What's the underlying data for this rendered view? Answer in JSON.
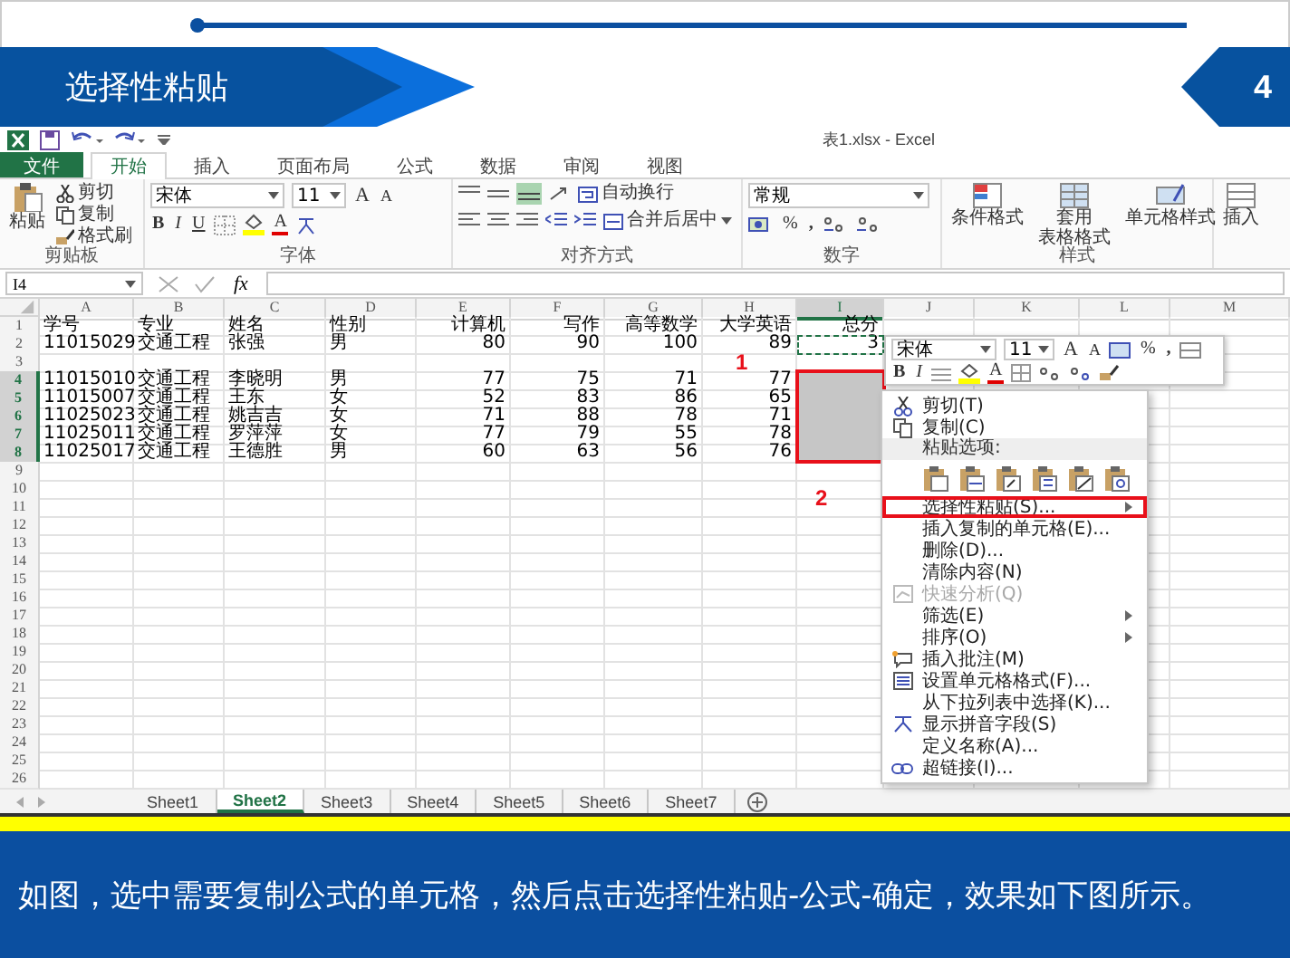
{
  "slide": {
    "title": "选择性粘贴",
    "page_number": "4",
    "caption": "如图，选中需要复制公式的单元格，然后点击选择性粘贴-公式-确定，效果如下图所示。"
  },
  "excel": {
    "window_title": "表1.xlsx - Excel",
    "tabs": [
      {
        "label": "文件",
        "kind": "file",
        "selected": false
      },
      {
        "label": "开始",
        "kind": "tab",
        "selected": true
      },
      {
        "label": "插入",
        "kind": "tab",
        "selected": false
      },
      {
        "label": "页面布局",
        "kind": "tab",
        "selected": false
      },
      {
        "label": "公式",
        "kind": "tab",
        "selected": false
      },
      {
        "label": "数据",
        "kind": "tab",
        "selected": false
      },
      {
        "label": "审阅",
        "kind": "tab",
        "selected": false
      },
      {
        "label": "视图",
        "kind": "tab",
        "selected": false
      }
    ],
    "ribbon": {
      "clipboard": {
        "label": "剪贴板",
        "paste": "粘贴",
        "cut": "剪切",
        "copy": "复制",
        "format_painter": "格式刷"
      },
      "font": {
        "label": "字体",
        "font_name": "宋体",
        "font_size": "11",
        "grow": "A",
        "shrink": "A",
        "bold": "B",
        "italic": "I",
        "underline": "U",
        "font_color": "A"
      },
      "alignment": {
        "label": "对齐方式",
        "wrap_text": "自动换行",
        "merge_center": "合并后居中"
      },
      "number": {
        "label": "数字",
        "format": "常规",
        "percent": "%",
        "comma": ","
      },
      "styles": {
        "label": "样式",
        "conditional": [
          "条件格式"
        ],
        "table": [
          "套用",
          "表格格式"
        ],
        "cell_styles": [
          "单元格样式"
        ]
      },
      "cells": {
        "insert": "插入"
      }
    },
    "name_box": "I4",
    "function_label": "fx",
    "columns": [
      {
        "label": "A",
        "kind": "text",
        "selected": false
      },
      {
        "label": "B",
        "kind": "text",
        "selected": false
      },
      {
        "label": "C",
        "kind": "text",
        "selected": false
      },
      {
        "label": "D",
        "kind": "text",
        "selected": false
      },
      {
        "label": "E",
        "kind": "number",
        "selected": false
      },
      {
        "label": "F",
        "kind": "number",
        "selected": false
      },
      {
        "label": "G",
        "kind": "number",
        "selected": false
      },
      {
        "label": "H",
        "kind": "number",
        "selected": false
      },
      {
        "label": "I",
        "kind": "number",
        "selected": true
      },
      {
        "label": "J",
        "selected": false
      },
      {
        "label": "K",
        "selected": false
      },
      {
        "label": "L",
        "selected": false
      },
      {
        "label": "M",
        "selected": false
      }
    ],
    "rows": [
      {
        "number": "1",
        "selected": false,
        "copied": false,
        "cells": [
          "学号",
          "专业",
          "姓名",
          "性别",
          "计算机",
          "写作",
          "高等数学",
          "大学英语",
          "总分"
        ]
      },
      {
        "number": "2",
        "selected": false,
        "copied": true,
        "cells": [
          "11015029",
          "交通工程",
          "张强",
          "男",
          "80",
          "90",
          "100",
          "89",
          "3"
        ]
      },
      {
        "number": "3",
        "selected": false,
        "copied": false,
        "cells": []
      },
      {
        "number": "4",
        "selected": true,
        "copied": false,
        "cells": [
          "11015010",
          "交通工程",
          "李晓明",
          "男",
          "77",
          "75",
          "71",
          "77"
        ]
      },
      {
        "number": "5",
        "selected": true,
        "copied": false,
        "cells": [
          "11015007",
          "交通工程",
          "王东",
          "女",
          "52",
          "83",
          "86",
          "65"
        ]
      },
      {
        "number": "6",
        "selected": true,
        "copied": false,
        "cells": [
          "11025023",
          "交通工程",
          "姚吉吉",
          "女",
          "71",
          "88",
          "78",
          "71"
        ]
      },
      {
        "number": "7",
        "selected": true,
        "copied": false,
        "cells": [
          "11025011",
          "交通工程",
          "罗萍萍",
          "女",
          "77",
          "79",
          "55",
          "78"
        ]
      },
      {
        "number": "8",
        "selected": true,
        "copied": false,
        "cells": [
          "11025017",
          "交通工程",
          "王德胜",
          "男",
          "60",
          "63",
          "56",
          "76"
        ]
      },
      {
        "number": "9",
        "selected": false,
        "copied": false,
        "cells": []
      },
      {
        "number": "10",
        "selected": false,
        "copied": false,
        "cells": []
      },
      {
        "number": "11",
        "selected": false,
        "copied": false,
        "cells": []
      },
      {
        "number": "12",
        "selected": false,
        "copied": false,
        "cells": []
      },
      {
        "number": "13",
        "selected": false,
        "copied": false,
        "cells": []
      },
      {
        "number": "14",
        "selected": false,
        "copied": false,
        "cells": []
      },
      {
        "number": "15",
        "selected": false,
        "copied": false,
        "cells": []
      },
      {
        "number": "16",
        "selected": false,
        "copied": false,
        "cells": []
      },
      {
        "number": "17",
        "selected": false,
        "copied": false,
        "cells": []
      },
      {
        "number": "18",
        "selected": false,
        "copied": false,
        "cells": []
      },
      {
        "number": "19",
        "selected": false,
        "copied": false,
        "cells": []
      },
      {
        "number": "20",
        "selected": false,
        "copied": false,
        "cells": []
      },
      {
        "number": "21",
        "selected": false,
        "copied": false,
        "cells": []
      },
      {
        "number": "22",
        "selected": false,
        "copied": false,
        "cells": []
      },
      {
        "number": "23",
        "selected": false,
        "copied": false,
        "cells": []
      },
      {
        "number": "24",
        "selected": false,
        "copied": false,
        "cells": []
      },
      {
        "number": "25",
        "selected": false,
        "copied": false,
        "cells": []
      },
      {
        "number": "26",
        "selected": false,
        "copied": false,
        "cells": []
      }
    ],
    "selection_marker": "1",
    "mini_toolbar": {
      "font": "宋体",
      "size": "11",
      "grow": "A",
      "shrink": "A",
      "percent": "%",
      "comma": ",",
      "bold": "B",
      "italic": "I",
      "font_color": "A"
    },
    "context_menu": [
      {
        "kind": "cut",
        "label": "剪切(T)",
        "submenu": false,
        "disabled": false
      },
      {
        "kind": "copy",
        "label": "复制(C)",
        "submenu": false,
        "disabled": false
      },
      {
        "kind": "heading",
        "label": "粘贴选项:"
      },
      {
        "kind": "paste_options"
      },
      {
        "kind": "plain",
        "label": "选择性粘贴(S)...",
        "submenu": true,
        "disabled": false,
        "marker": "2"
      },
      {
        "kind": "plain",
        "label": "插入复制的单元格(E)...",
        "submenu": false,
        "disabled": false
      },
      {
        "kind": "plain",
        "label": "删除(D)...",
        "submenu": false,
        "disabled": false
      },
      {
        "kind": "plain",
        "label": "清除内容(N)",
        "submenu": false,
        "disabled": false
      },
      {
        "kind": "quick_analysis",
        "label": "快速分析(Q)",
        "submenu": false,
        "disabled": true
      },
      {
        "kind": "plain",
        "label": "筛选(E)",
        "submenu": true,
        "disabled": false
      },
      {
        "kind": "plain",
        "label": "排序(O)",
        "submenu": true,
        "disabled": false
      },
      {
        "kind": "comment",
        "label": "插入批注(M)",
        "submenu": false,
        "disabled": false
      },
      {
        "kind": "format",
        "label": "设置单元格格式(F)...",
        "submenu": false,
        "disabled": false
      },
      {
        "kind": "plain",
        "label": "从下拉列表中选择(K)...",
        "submenu": false,
        "disabled": false
      },
      {
        "kind": "phonetic",
        "label": "显示拼音字段(S)",
        "submenu": false,
        "disabled": false
      },
      {
        "kind": "plain",
        "label": "定义名称(A)...",
        "submenu": false,
        "disabled": false
      },
      {
        "kind": "link",
        "label": "超链接(I)...",
        "submenu": false,
        "disabled": false
      }
    ],
    "sheets": [
      {
        "label": "Sheet1",
        "selected": false
      },
      {
        "label": "Sheet2",
        "selected": true
      },
      {
        "label": "Sheet3",
        "selected": false
      },
      {
        "label": "Sheet4",
        "selected": false
      },
      {
        "label": "Sheet5",
        "selected": false
      },
      {
        "label": "Sheet6",
        "selected": false
      },
      {
        "label": "Sheet7",
        "selected": false
      }
    ]
  }
}
